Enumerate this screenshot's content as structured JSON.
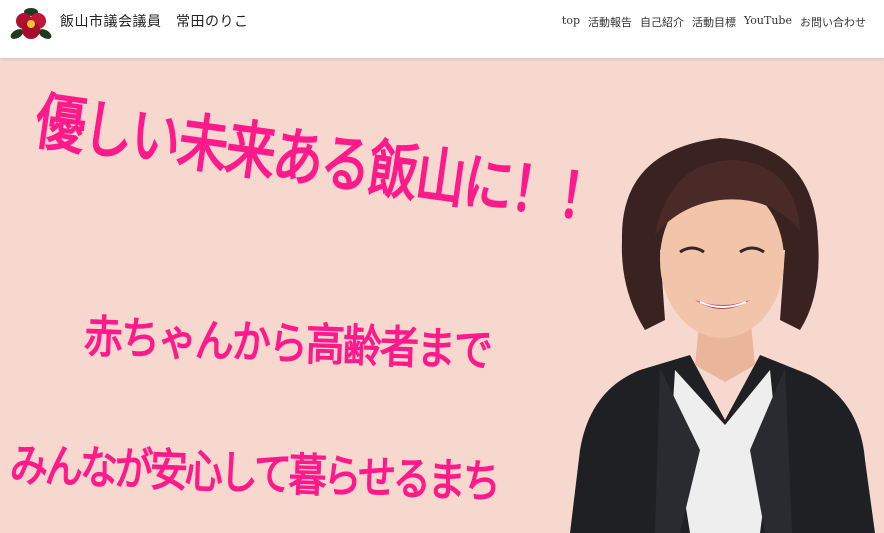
{
  "header": {
    "site_title": "飯山市議会議員　常田のりこ",
    "nav": [
      "top",
      "活動報告",
      "自己紹介",
      "活動目標",
      "YouTube",
      "お問い合わせ"
    ]
  },
  "hero": {
    "slogan_line1": "優しい未来ある飯山に！！",
    "slogan_line2": "赤ちゃんから高齢者まで",
    "slogan_line3": "みんなが安心して暮らせるまち"
  },
  "colors": {
    "accent_pink": "#ff1a8c",
    "hero_background": "#f6d8cf",
    "header_background": "#ffffff"
  },
  "icons": {
    "logo": "camellia-flower-logo"
  }
}
